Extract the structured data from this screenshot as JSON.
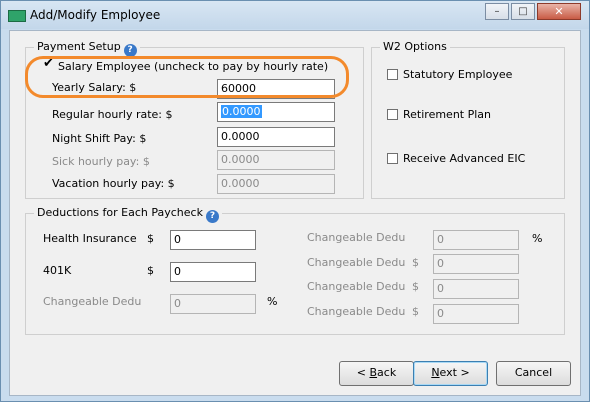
{
  "window": {
    "title": "Add/Modify Employee"
  },
  "titlebar_buttons": {
    "minimize": "–",
    "maximize": "□",
    "close": "✕"
  },
  "payment_setup": {
    "legend": "Payment Setup",
    "help": "?",
    "salary_checkbox_label": "Salary Employee (uncheck to pay by hourly rate)",
    "salary_checked": true,
    "check_glyph": "✔",
    "yearly_salary_label": "Yearly Salary: $",
    "yearly_salary_value": "60000",
    "regular_rate_label": "Regular hourly rate: $",
    "regular_rate_value": "0.0000",
    "night_shift_label": "Night Shift Pay: $",
    "night_shift_value": "0.0000",
    "sick_label": "Sick hourly pay: $",
    "sick_value": "0.0000",
    "vacation_label": "Vacation hourly pay: $",
    "vacation_value": "0.0000"
  },
  "w2_options": {
    "legend": "W2 Options",
    "statutory": "Statutory Employee",
    "retirement": "Retirement Plan",
    "advanced_eic": "Receive Advanced EIC"
  },
  "deductions": {
    "legend": "Deductions for Each Paycheck",
    "help": "?",
    "health_label": "Health Insurance",
    "health_currency": "$",
    "health_value": "0",
    "k401_label": "401K",
    "k401_currency": "$",
    "k401_value": "0",
    "changeable_left_label": "Changeable Dedu",
    "changeable_left_value": "0",
    "changeable_left_unit": "%",
    "right_rows": [
      {
        "label": "Changeable Dedu",
        "symbol": "",
        "value": "0",
        "unit": "%"
      },
      {
        "label": "Changeable Dedu",
        "symbol": "$",
        "value": "0"
      },
      {
        "label": "Changeable Dedu",
        "symbol": "$",
        "value": "0"
      },
      {
        "label": "Changeable Dedu",
        "symbol": "$",
        "value": "0"
      }
    ]
  },
  "buttons": {
    "back_prefix": "< ",
    "back_ul": "B",
    "back_rest": "ack",
    "next_ul": "N",
    "next_rest": "ext >",
    "cancel": "Cancel"
  },
  "colors": {
    "highlight": "#f38a2c",
    "selection": "#3399ff",
    "title_bar": "#c9dcee"
  }
}
